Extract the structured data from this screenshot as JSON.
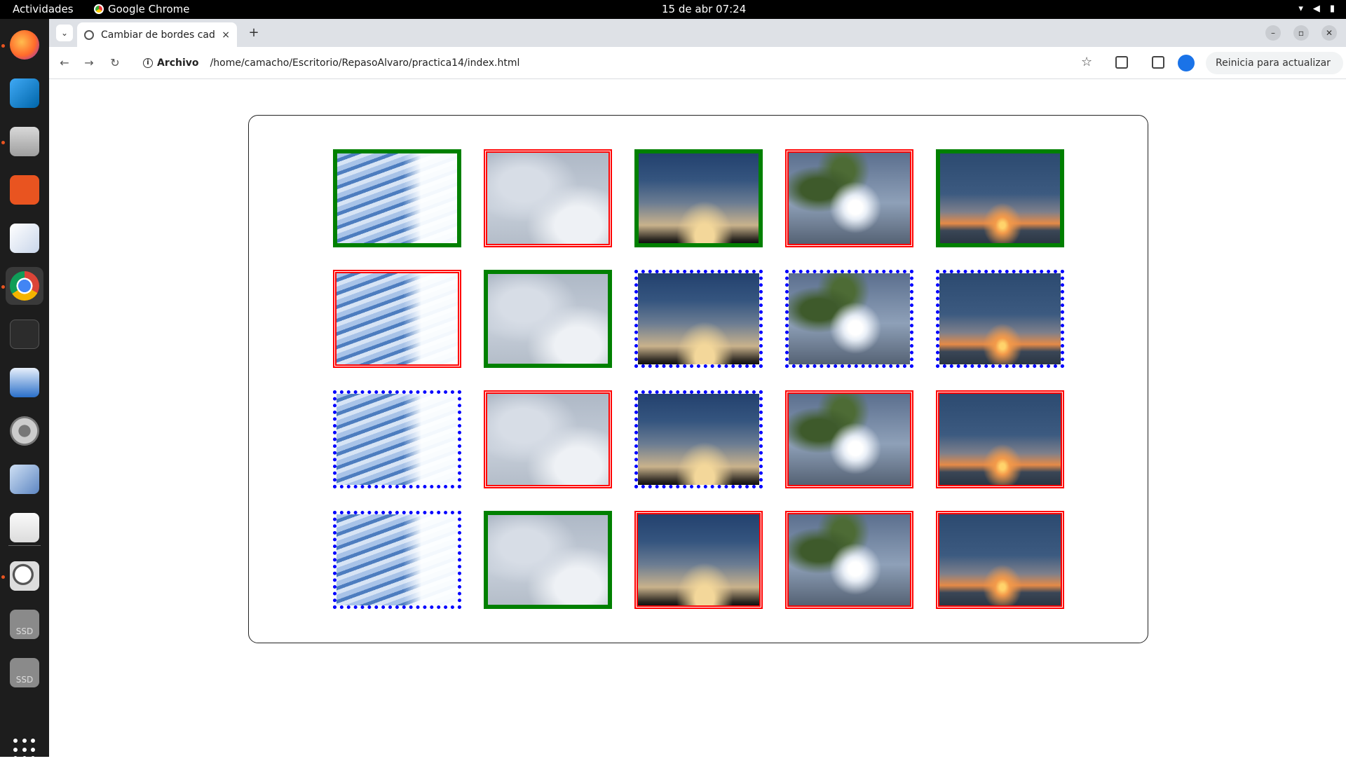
{
  "system": {
    "activities": "Actividades",
    "app_name": "Google Chrome",
    "clock": "15 de abr  07:24"
  },
  "dock": {
    "items": [
      {
        "icon": "firefox-icon",
        "running": true
      },
      {
        "icon": "vscode-icon",
        "running": false
      },
      {
        "icon": "files-icon",
        "running": true
      },
      {
        "icon": "app-center-icon",
        "running": false
      },
      {
        "icon": "text-editor-icon",
        "running": false
      },
      {
        "icon": "chrome-icon",
        "running": true,
        "active": true
      },
      {
        "icon": "terminal-icon",
        "running": false
      },
      {
        "icon": "writer-icon",
        "running": false
      },
      {
        "icon": "settings-icon",
        "running": false
      },
      {
        "icon": "virtualbox-icon",
        "running": false
      },
      {
        "icon": "document-viewer-icon",
        "running": false
      },
      {
        "icon": "magnifier-icon",
        "running": true
      },
      {
        "icon": "ssd-drive-icon",
        "label": "SSD"
      },
      {
        "icon": "ssd-drive-icon",
        "label": "SSD"
      }
    ]
  },
  "browser": {
    "tab_title": "Cambiar de bordes cada",
    "address_scheme": "Archivo",
    "address_path": "/home/camacho/Escritorio/RepasoAlvaro/practica14/index.html",
    "update_button": "Reinicia para actualizar",
    "menu_glyph": "⋮",
    "close_tab_glyph": "×",
    "new_tab_glyph": "+",
    "minimize_glyph": "–",
    "maximize_glyph": "▫",
    "close_window_glyph": "✕",
    "back_glyph": "←",
    "forward_glyph": "→",
    "reload_glyph": "↻",
    "star_glyph": "☆",
    "tab_list_glyph": "⌄",
    "info_glyph": "i"
  },
  "gallery": {
    "photos": [
      "mackerel-clouds",
      "overcast-sky",
      "dusk-clouds",
      "palm-backlit",
      "sunset-sea"
    ],
    "border_colors": {
      "green": "#008000",
      "red": "#ff0000",
      "blue": "#0000ff"
    },
    "rows": [
      [
        "green",
        "red",
        "green",
        "red",
        "green"
      ],
      [
        "red",
        "green",
        "blue",
        "blue",
        "blue"
      ],
      [
        "blue",
        "red",
        "blue",
        "red",
        "red"
      ],
      [
        "blue",
        "green",
        "red",
        "red",
        "red"
      ]
    ]
  }
}
